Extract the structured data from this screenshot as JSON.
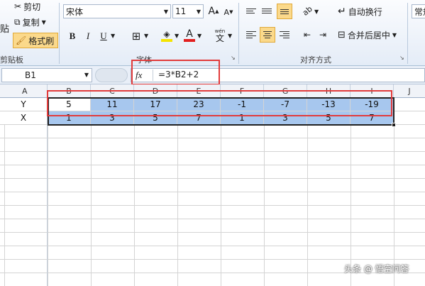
{
  "clipboard": {
    "cut_label": "剪切",
    "copy_label": "复制",
    "format_painter_label": "格式刷",
    "group_label": "剪贴板",
    "paste_partial": "贴"
  },
  "font": {
    "family_value": "宋体",
    "size_value": "11",
    "bold": "B",
    "italic": "I",
    "underline": "U",
    "fill_icon": "fill-bucket-icon",
    "font_color_letter": "A",
    "phonetic_label": "wén",
    "group_label": "字体",
    "grow_label": "A",
    "shrink_label": "A"
  },
  "alignment": {
    "wrap_label": "自动换行",
    "merge_label": "合并后居中",
    "group_label": "对齐方式"
  },
  "number": {
    "format_partial": "常规"
  },
  "formula_bar": {
    "name_box": "B1",
    "fx_label": "fx",
    "formula": "=3*B2+2"
  },
  "columns": [
    "A",
    "B",
    "C",
    "D",
    "E",
    "F",
    "G",
    "H",
    "I",
    "J"
  ],
  "rows": [
    {
      "label": "Y",
      "values": [
        "5",
        "11",
        "17",
        "23",
        "-1",
        "-7",
        "-13",
        "-19"
      ]
    },
    {
      "label": "X",
      "values": [
        "1",
        "3",
        "5",
        "7",
        "1",
        "3",
        "5",
        "7"
      ]
    }
  ],
  "watermark": "头条 @ 悟空问答",
  "colors": {
    "accent_red": "#e23b3b",
    "selection_blue": "#a7c7ee",
    "header_highlight": "#f7d98a"
  }
}
